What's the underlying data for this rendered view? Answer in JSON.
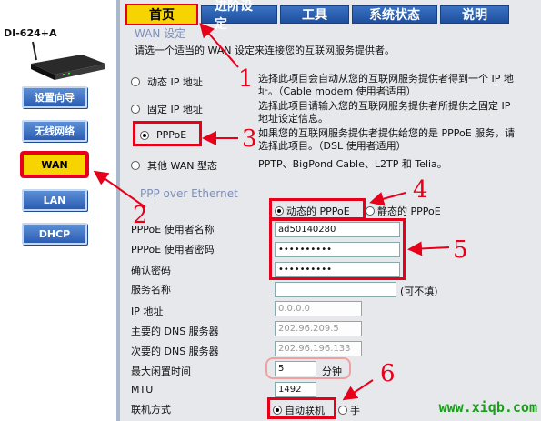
{
  "model": "DI-624+A",
  "sidebar": {
    "items": [
      {
        "label": "设置向导"
      },
      {
        "label": "无线网络"
      },
      {
        "label": "WAN"
      },
      {
        "label": "LAN"
      },
      {
        "label": "DHCP"
      }
    ]
  },
  "tabs": [
    "首页",
    "进阶设定",
    "工具",
    "系统状态",
    "说明"
  ],
  "wan": {
    "title": "WAN 设定",
    "intro": "请选一个适当的 WAN 设定来连接您的互联网服务提供者。",
    "options": [
      {
        "label": "动态 IP 地址",
        "desc": "选择此项目会自动从您的互联网服务提供者得到一个 IP 地址。（Cable modem 使用者适用）",
        "checked": false
      },
      {
        "label": "固定 IP 地址",
        "desc": "选择此项目请输入您的互联网服务提供者所提供之固定 IP 地址设定信息。",
        "checked": false
      },
      {
        "label": "PPPoE",
        "desc": "如果您的互联网服务提供者提供给您的是 PPPoE 服务，请选择此项目。（DSL 使用者适用）",
        "checked": true
      },
      {
        "label": "其他 WAN 型态",
        "desc": "PPTP、BigPond Cable、L2TP 和 Telia。",
        "checked": false
      }
    ]
  },
  "pppoe": {
    "title": "PPP over Ethernet",
    "mode_dynamic": "动态的 PPPoE",
    "mode_static": "静态的 PPPoE",
    "username_label": "PPPoE 使用者名称",
    "username": "ad50140280",
    "password_label": "PPPoE 使用者密码",
    "password": "••••••••••",
    "confirm_label": "确认密码",
    "confirm": "••••••••••",
    "service_label": "服务名称",
    "service": "",
    "optional": "(可不填)",
    "ip_label": "IP 地址",
    "ip": "0.0.0.0",
    "dns1_label": "主要的 DNS 服务器",
    "dns1": "202.96.209.5",
    "dns2_label": "次要的 DNS 服务器",
    "dns2": "202.96.196.133",
    "idle_label": "最大闲置时间",
    "idle": "5",
    "idle_unit": "分钟",
    "mtu_label": "MTU",
    "mtu": "1492",
    "connect_label": "联机方式",
    "connect_auto": "自动联机",
    "connect_manual": "手"
  },
  "callouts": [
    "1",
    "2",
    "3",
    "4",
    "5",
    "6"
  ],
  "watermark": "www.xiqb.com",
  "colors": {
    "accent_red": "#e8001a",
    "tab_blue": "#2a5db3",
    "active_yellow": "#f7d400"
  }
}
